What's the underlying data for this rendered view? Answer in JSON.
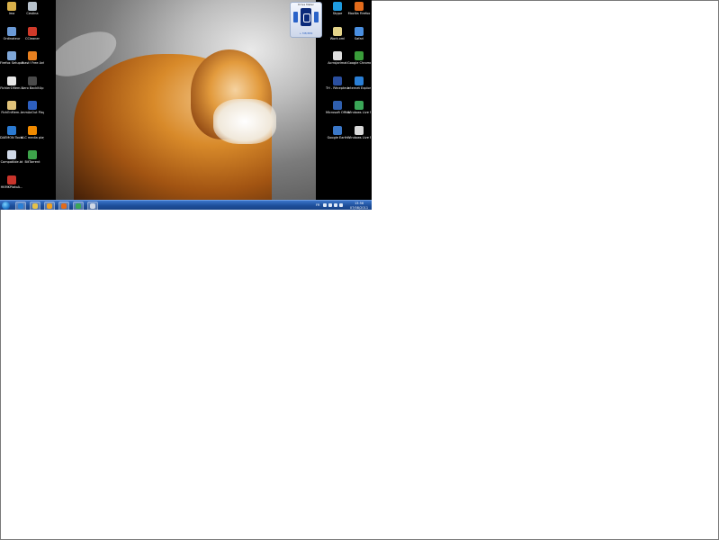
{
  "desktop": {
    "left_icons": [
      {
        "label": "Ima",
        "icon": "folder-icon",
        "color": "#d9b04a"
      },
      {
        "label": "Cestina",
        "icon": "recycle-bin-icon",
        "color": "#b8c2cc"
      },
      {
        "label": "Ordinateur",
        "icon": "computer-icon",
        "color": "#6b9ad6"
      },
      {
        "label": "CCleaner",
        "icon": "ccleaner-icon",
        "color": "#d03a2a"
      },
      {
        "label": "Firefox Setup 3.6.13",
        "icon": "installer-icon",
        "color": "#7fa7d8"
      },
      {
        "label": "avast! Free Antivirus",
        "icon": "avast-icon",
        "color": "#e8801f"
      },
      {
        "label": "Fichier1Mem...",
        "icon": "document-icon",
        "color": "#e6e6e6"
      },
      {
        "label": "Nero BackItUp",
        "icon": "backup-icon",
        "color": "#4a4a4a"
      },
      {
        "label": "FichEnMem...",
        "icon": "document-icon",
        "color": "#e0c27a"
      },
      {
        "label": "ImmAvOut Player",
        "icon": "player-icon",
        "color": "#2d5fbf"
      },
      {
        "label": "DAEMON Tools Lite",
        "icon": "daemon-tools-icon",
        "color": "#2b7ad1"
      },
      {
        "label": "VLC media player",
        "icon": "vlc-icon",
        "color": "#f08a00"
      },
      {
        "label": "Compatible.bt",
        "icon": "document-icon",
        "color": "#cfd8e6"
      },
      {
        "label": "BitTorrent",
        "icon": "bittorrent-icon",
        "color": "#3da34a"
      },
      {
        "label": "HKMKPlatoA...",
        "icon": "app-icon",
        "color": "#c8342b"
      }
    ],
    "right_icons": [
      {
        "label": "Skype",
        "icon": "skype-icon",
        "color": "#1e9be0"
      },
      {
        "label": "Mozilla Firefox",
        "icon": "firefox-icon",
        "color": "#e36b1b"
      },
      {
        "label": "Work.xml",
        "icon": "document-icon",
        "color": "#e4d48a"
      },
      {
        "label": "Safari",
        "icon": "safari-icon",
        "color": "#4a8fe0"
      },
      {
        "label": "Acrrojarimat",
        "icon": "document-icon",
        "color": "#dedede"
      },
      {
        "label": "Google Chrome",
        "icon": "chrome-icon",
        "color": "#3a9d3a"
      },
      {
        "label": "TH - Récepteur",
        "icon": "media-icon",
        "color": "#2a4fa0"
      },
      {
        "label": "Internet Explorer",
        "icon": "ie-icon",
        "color": "#2a7fd6"
      },
      {
        "label": "Microsoft Office Word 2007",
        "icon": "word-icon",
        "color": "#2f5faf"
      },
      {
        "label": "Windows Live Messenger",
        "icon": "messenger-icon",
        "color": "#3aa657"
      },
      {
        "label": "Google Earth",
        "icon": "google-earth-icon",
        "color": "#3b78c8"
      },
      {
        "label": "Windows Live Mail",
        "icon": "mail-icon",
        "color": "#d9d9d9"
      }
    ]
  },
  "gadget": {
    "title": "Drive Meter",
    "footer": "+ MB/MIN"
  },
  "taskbar": {
    "pinned": [
      {
        "name": "ie-taskbar-icon",
        "color": "#2a7fd6"
      },
      {
        "name": "explorer-taskbar-icon",
        "color": "#e6c24a"
      },
      {
        "name": "media-player-taskbar-icon",
        "color": "#f0a020"
      },
      {
        "name": "firefox-taskbar-icon",
        "color": "#e36b1b"
      },
      {
        "name": "messenger-taskbar-icon",
        "color": "#3aa657"
      },
      {
        "name": "mail-taskbar-icon",
        "color": "#cfd8e6"
      }
    ],
    "tray": {
      "lang": "FR",
      "time": "13:56",
      "date": "07/08/2011"
    }
  }
}
